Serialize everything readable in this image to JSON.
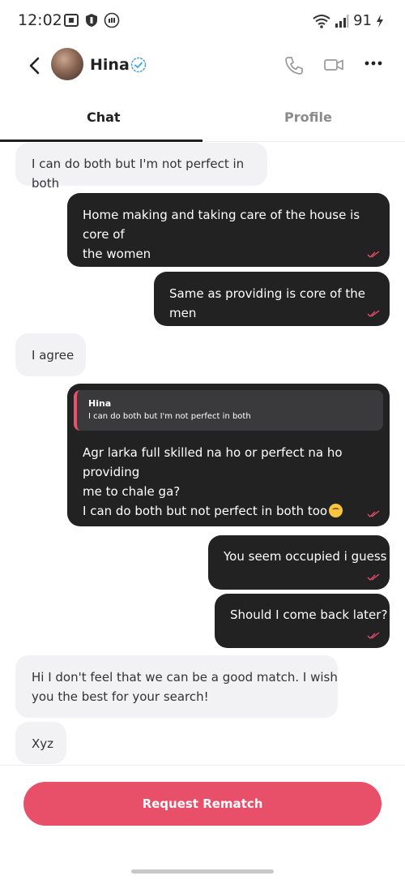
{
  "status_bar": {
    "time": "12:02",
    "battery": "91"
  },
  "header": {
    "contact_name": "Hina"
  },
  "tabs": [
    {
      "label": "Chat"
    },
    {
      "label": "Profile"
    }
  ],
  "messages": [
    {
      "dir": "in",
      "lines": [
        "I can do both but I'm not perfect in both"
      ]
    },
    {
      "dir": "out",
      "lines": [
        "Home making and taking care of the house is core of",
        "the women"
      ]
    },
    {
      "dir": "out",
      "lines": [
        "Same as providing is core of the men"
      ]
    },
    {
      "dir": "in",
      "lines": [
        "I agree"
      ]
    },
    {
      "dir": "out",
      "reply_to": {
        "name": "Hina",
        "text": "I can do both but I'm not perfect in both"
      },
      "lines": [
        "Agr larka full skilled na ho or perfect na ho providing",
        "me to chale ga?",
        "I can do both but not perfect in both too"
      ]
    },
    {
      "dir": "out",
      "lines": [
        "You seem occupied i guess"
      ]
    },
    {
      "dir": "out",
      "lines": [
        "Should I come back later?"
      ]
    },
    {
      "dir": "in",
      "lines": [
        "Hi I don't feel that we can be a good match. I wish",
        "you the best for your search!"
      ]
    },
    {
      "dir": "in",
      "lines": [
        "Xyz"
      ]
    }
  ],
  "footer": {
    "rematch_label": "Request Rematch"
  },
  "colors": {
    "accent": "#e8506a",
    "outgoing_bubble": "#222222",
    "incoming_bubble": "#f2f1f3",
    "read_tick": "#e8506a",
    "verified": "#3fa6e0"
  },
  "icons": [
    "back-chevron-icon",
    "verified-badge-icon",
    "phone-icon",
    "video-camera-icon",
    "more-dots-icon"
  ]
}
